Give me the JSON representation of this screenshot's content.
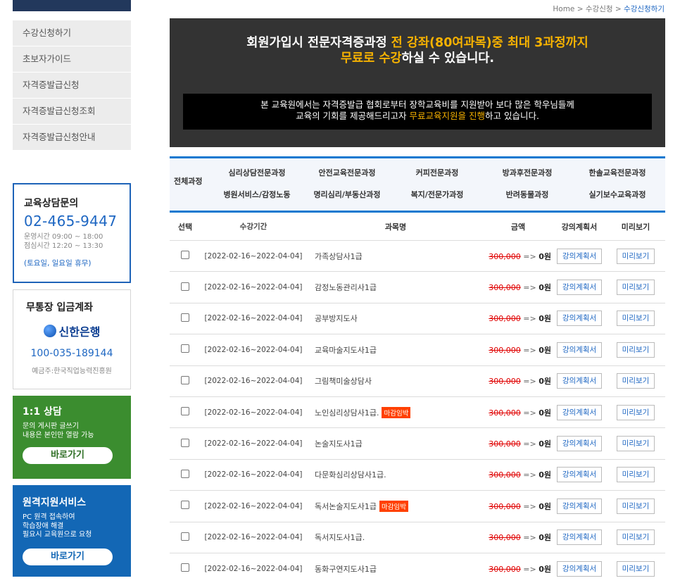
{
  "breadcrumb": {
    "home": "Home",
    "sep1": ">",
    "section": "수강신청",
    "sep2": ">",
    "current": "수강신청하기"
  },
  "menu": [
    "수강신청하기",
    "초보자가이드",
    "자격증발급신청",
    "자격증발급신청조회",
    "자격증발급신청안내"
  ],
  "consult": {
    "title": "교육상담문의",
    "phone": "02-465-9447",
    "hours1": "운영시간 09:00 ~ 18:00",
    "hours2": "점심시간 12:20 ~ 13:30",
    "holiday": "(토요일, 일요일 휴무)"
  },
  "bank": {
    "title": "무통장 입금계좌",
    "name": "신한은행",
    "account": "100-035-189144",
    "owner": "예금주:한국직업능력진흥원"
  },
  "one_to_one": {
    "title": "1:1 상담",
    "desc1": "문의 게시판 글쓰기",
    "desc2": "내용은 본인만 열람 가능",
    "button": "바로가기",
    "color": "#3b8d2f"
  },
  "remote": {
    "title": "원격지원서비스",
    "desc1": "PC 원격 접속하여",
    "desc2": "학습장애 해결",
    "desc3": "필요시 교육원으로 요청",
    "button": "바로가기",
    "color": "#1367b5"
  },
  "banner": {
    "l1a": "회원가입시 전문자격증과정 ",
    "l1b": "전 강좌(80여과목)중 최대 3과정까지",
    "l2a": "무료로 수강",
    "l2b": "하실 수 있습니다.",
    "s1": "본 교육원에서는 자격증발급 협회로부터 장학교육비를 지원받아 보다 많은 학우님들께",
    "s2a": "교육의 기회를 제공해드리고자 ",
    "s2b": "무료교육지원을 진행",
    "s2c": "하고 있습니다.",
    "accent": "#f7b200"
  },
  "categories": {
    "all": "전체과정",
    "row1": [
      "심리상담전문과정",
      "안전교육전문과정",
      "커피전문과정",
      "방과후전문과정",
      "한솔교육전문과정"
    ],
    "row2": [
      "병원서비스/감정노동",
      "명리심리/부동산과정",
      "복지/전문가과정",
      "반려동물과정",
      "실기보수교육과정"
    ]
  },
  "table": {
    "headers": {
      "select": "선택",
      "period": "수강기간",
      "course": "과목명",
      "price": "금액",
      "plan": "강의계획서",
      "preview": "미리보기"
    },
    "rows": [
      {
        "period": "[2022-02-16~2022-04-04]",
        "name": "가족상담사1급",
        "badge": "",
        "orig": "300,000",
        "arrow": "=>",
        "price": "0원",
        "plan": "강의계획서",
        "preview": "미리보기"
      },
      {
        "period": "[2022-02-16~2022-04-04]",
        "name": "감정노동관리사1급",
        "badge": "",
        "orig": "300,000",
        "arrow": "=>",
        "price": "0원",
        "plan": "강의계획서",
        "preview": "미리보기"
      },
      {
        "period": "[2022-02-16~2022-04-04]",
        "name": "공부방지도사",
        "badge": "",
        "orig": "300,000",
        "arrow": "=>",
        "price": "0원",
        "plan": "강의계획서",
        "preview": "미리보기"
      },
      {
        "period": "[2022-02-16~2022-04-04]",
        "name": "교육마술지도사1급",
        "badge": "",
        "orig": "300,000",
        "arrow": "=>",
        "price": "0원",
        "plan": "강의계획서",
        "preview": "미리보기"
      },
      {
        "period": "[2022-02-16~2022-04-04]",
        "name": "그림책미술상담사",
        "badge": "",
        "orig": "300,000",
        "arrow": "=>",
        "price": "0원",
        "plan": "강의계획서",
        "preview": "미리보기"
      },
      {
        "period": "[2022-02-16~2022-04-04]",
        "name": "노인심리상담사1급.",
        "badge": "마감임박",
        "orig": "300,000",
        "arrow": "=>",
        "price": "0원",
        "plan": "강의계획서",
        "preview": "미리보기"
      },
      {
        "period": "[2022-02-16~2022-04-04]",
        "name": "논술지도사1급",
        "badge": "",
        "orig": "300,000",
        "arrow": "=>",
        "price": "0원",
        "plan": "강의계획서",
        "preview": "미리보기"
      },
      {
        "period": "[2022-02-16~2022-04-04]",
        "name": "다문화심리상담사1급.",
        "badge": "",
        "orig": "300,000",
        "arrow": "=>",
        "price": "0원",
        "plan": "강의계획서",
        "preview": "미리보기"
      },
      {
        "period": "[2022-02-16~2022-04-04]",
        "name": "독서논술지도사1급",
        "badge": "마감임박",
        "orig": "300,000",
        "arrow": "=>",
        "price": "0원",
        "plan": "강의계획서",
        "preview": "미리보기"
      },
      {
        "period": "[2022-02-16~2022-04-04]",
        "name": "독서지도사1급.",
        "badge": "",
        "orig": "300,000",
        "arrow": "=>",
        "price": "0원",
        "plan": "강의계획서",
        "preview": "미리보기"
      },
      {
        "period": "[2022-02-16~2022-04-04]",
        "name": "동화구연지도사1급",
        "badge": "",
        "orig": "300,000",
        "arrow": "=>",
        "price": "0원",
        "plan": "강의계획서",
        "preview": "미리보기"
      }
    ]
  }
}
